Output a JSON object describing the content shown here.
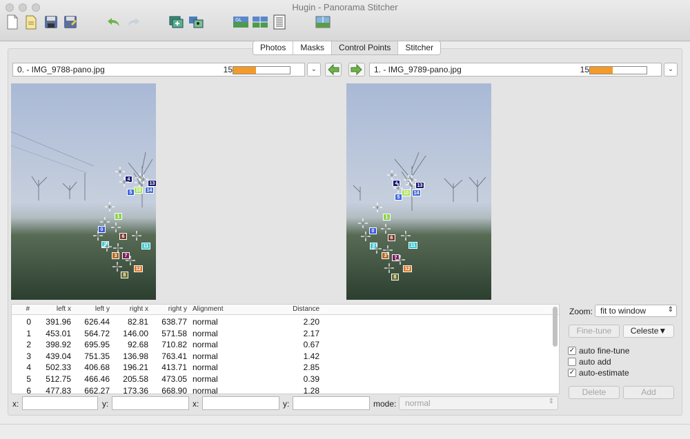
{
  "window": {
    "title": "Hugin - Panorama Stitcher"
  },
  "tabs": [
    {
      "label": "Photos",
      "active": false
    },
    {
      "label": "Masks",
      "active": false
    },
    {
      "label": "Control Points",
      "active": true
    },
    {
      "label": "Stitcher",
      "active": false
    }
  ],
  "left_image": {
    "label": "0. - IMG_9788-pano.jpg",
    "count": "15",
    "progress": 0.4
  },
  "right_image": {
    "label": "1. - IMG_9789-pano.jpg",
    "count": "15",
    "progress": 0.4
  },
  "table": {
    "headers": [
      "#",
      "left x",
      "left y",
      "right x",
      "right y",
      "Alignment",
      "Distance"
    ],
    "rows": [
      [
        "0",
        "391.96",
        "626.44",
        "82.81",
        "638.77",
        "normal",
        "2.20"
      ],
      [
        "1",
        "453.01",
        "564.72",
        "146.00",
        "571.58",
        "normal",
        "2.17"
      ],
      [
        "2",
        "398.92",
        "695.95",
        "92.68",
        "710.82",
        "normal",
        "0.67"
      ],
      [
        "3",
        "439.04",
        "751.35",
        "136.98",
        "763.41",
        "normal",
        "1.42"
      ],
      [
        "4",
        "502.33",
        "406.68",
        "196.21",
        "413.71",
        "normal",
        "2.85"
      ],
      [
        "5",
        "512.75",
        "466.46",
        "205.58",
        "473.05",
        "normal",
        "0.39"
      ],
      [
        "6",
        "477.83",
        "662.27",
        "173.36",
        "668.90",
        "normal",
        "1.28"
      ]
    ]
  },
  "fields": {
    "x_label": "x:",
    "y_label": "y:",
    "mode_label": "mode:",
    "mode_value": "normal"
  },
  "controls": {
    "zoom_label": "Zoom:",
    "zoom_value": "fit to window",
    "fine_tune": "Fine-tune",
    "celeste": "Celeste▼",
    "auto_fine_tune": {
      "label": "auto fine-tune",
      "checked": true
    },
    "auto_add": {
      "label": "auto add",
      "checked": false
    },
    "auto_estimate": {
      "label": "auto-estimate",
      "checked": true
    },
    "delete": "Delete",
    "add": "Add"
  },
  "control_points": [
    {
      "id": "0",
      "color": "#3b5bdb"
    },
    {
      "id": "1",
      "color": "#8fd14f"
    },
    {
      "id": "2",
      "color": "#3fc7d6"
    },
    {
      "id": "3",
      "color": "#b5651d"
    },
    {
      "id": "4",
      "color": "#1c1c6e"
    },
    {
      "id": "5",
      "color": "#4169e1"
    },
    {
      "id": "6",
      "color": "#7a3b2e"
    },
    {
      "id": "7",
      "color": "#7a1f5a"
    },
    {
      "id": "8",
      "color": "#6b6b2a"
    },
    {
      "id": "10",
      "color": "#a6e35a"
    },
    {
      "id": "11",
      "color": "#35c9d4"
    },
    {
      "id": "12",
      "color": "#d9792a"
    },
    {
      "id": "13",
      "color": "#1c1c6e"
    },
    {
      "id": "14",
      "color": "#4a6fd0"
    }
  ]
}
